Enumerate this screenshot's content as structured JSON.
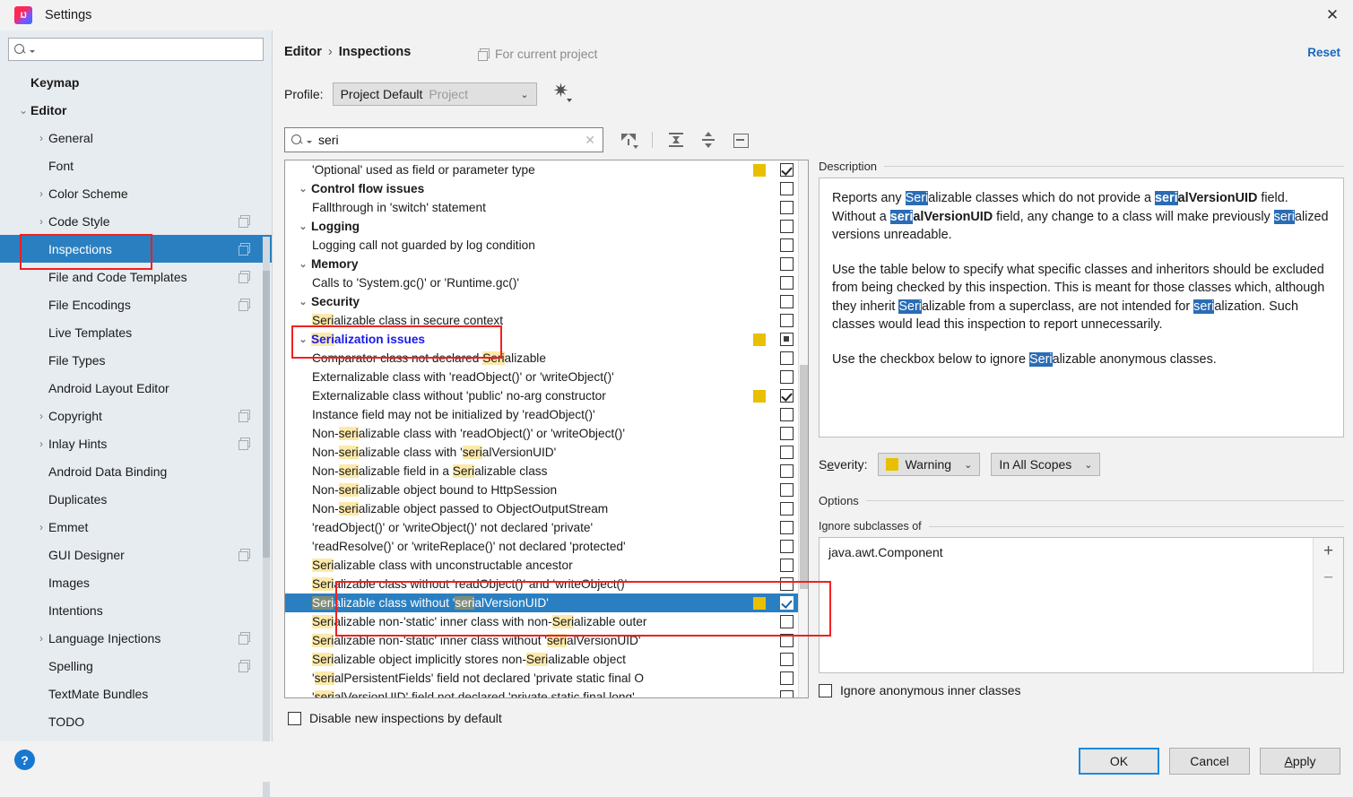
{
  "window": {
    "title": "Settings",
    "close_label": "✕",
    "logo": "intellij-idea-logo"
  },
  "sidebar": {
    "search_placeholder": "",
    "search_value": "",
    "items": [
      {
        "label": "Keymap",
        "indent": 0,
        "arrow": "",
        "bold": true,
        "copy": false,
        "selected": false
      },
      {
        "label": "Editor",
        "indent": 0,
        "arrow": "⌄",
        "bold": true,
        "copy": false,
        "selected": false
      },
      {
        "label": "General",
        "indent": 1,
        "arrow": "›",
        "bold": false,
        "copy": false,
        "selected": false
      },
      {
        "label": "Font",
        "indent": 1,
        "arrow": "",
        "bold": false,
        "copy": false,
        "selected": false
      },
      {
        "label": "Color Scheme",
        "indent": 1,
        "arrow": "›",
        "bold": false,
        "copy": false,
        "selected": false
      },
      {
        "label": "Code Style",
        "indent": 1,
        "arrow": "›",
        "bold": false,
        "copy": true,
        "selected": false
      },
      {
        "label": "Inspections",
        "indent": 1,
        "arrow": "",
        "bold": false,
        "copy": true,
        "selected": true
      },
      {
        "label": "File and Code Templates",
        "indent": 1,
        "arrow": "",
        "bold": false,
        "copy": true,
        "selected": false
      },
      {
        "label": "File Encodings",
        "indent": 1,
        "arrow": "",
        "bold": false,
        "copy": true,
        "selected": false
      },
      {
        "label": "Live Templates",
        "indent": 1,
        "arrow": "",
        "bold": false,
        "copy": false,
        "selected": false
      },
      {
        "label": "File Types",
        "indent": 1,
        "arrow": "",
        "bold": false,
        "copy": false,
        "selected": false
      },
      {
        "label": "Android Layout Editor",
        "indent": 1,
        "arrow": "",
        "bold": false,
        "copy": false,
        "selected": false
      },
      {
        "label": "Copyright",
        "indent": 1,
        "arrow": "›",
        "bold": false,
        "copy": true,
        "selected": false
      },
      {
        "label": "Inlay Hints",
        "indent": 1,
        "arrow": "›",
        "bold": false,
        "copy": true,
        "selected": false
      },
      {
        "label": "Android Data Binding",
        "indent": 1,
        "arrow": "",
        "bold": false,
        "copy": false,
        "selected": false
      },
      {
        "label": "Duplicates",
        "indent": 1,
        "arrow": "",
        "bold": false,
        "copy": false,
        "selected": false
      },
      {
        "label": "Emmet",
        "indent": 1,
        "arrow": "›",
        "bold": false,
        "copy": false,
        "selected": false
      },
      {
        "label": "GUI Designer",
        "indent": 1,
        "arrow": "",
        "bold": false,
        "copy": true,
        "selected": false
      },
      {
        "label": "Images",
        "indent": 1,
        "arrow": "",
        "bold": false,
        "copy": false,
        "selected": false
      },
      {
        "label": "Intentions",
        "indent": 1,
        "arrow": "",
        "bold": false,
        "copy": false,
        "selected": false
      },
      {
        "label": "Language Injections",
        "indent": 1,
        "arrow": "›",
        "bold": false,
        "copy": true,
        "selected": false
      },
      {
        "label": "Spelling",
        "indent": 1,
        "arrow": "",
        "bold": false,
        "copy": true,
        "selected": false
      },
      {
        "label": "TextMate Bundles",
        "indent": 1,
        "arrow": "",
        "bold": false,
        "copy": false,
        "selected": false
      },
      {
        "label": "TODO",
        "indent": 1,
        "arrow": "",
        "bold": false,
        "copy": false,
        "selected": false
      }
    ]
  },
  "header": {
    "breadcrumb_root": "Editor",
    "breadcrumb_sep": "›",
    "breadcrumb_leaf": "Inspections",
    "for_current_project": "For current project",
    "reset_label": "Reset",
    "profile_label": "Profile:",
    "profile_value": "Project Default",
    "profile_scope": "Project",
    "gear_icon": "gear-icon"
  },
  "find": {
    "value": "seri",
    "placeholder": "",
    "clear_label": "✕",
    "toolbar": [
      "filter-icon",
      "expand-all-icon",
      "collapse-all-icon",
      "box-icon"
    ]
  },
  "inspections": {
    "highlight_term": "seri",
    "disable_new_label": "Disable new inspections by default",
    "disable_new_checked": false,
    "rows": [
      {
        "text": "'Optional' used as field or parameter type",
        "group": false,
        "severity": true,
        "check": "checked",
        "selected": false
      },
      {
        "text": "Control flow issues",
        "group": true,
        "severity": false,
        "check": "none",
        "selected": false
      },
      {
        "text": "Fallthrough in 'switch' statement",
        "group": false,
        "severity": false,
        "check": "none",
        "selected": false
      },
      {
        "text": "Logging",
        "group": true,
        "severity": false,
        "check": "none",
        "selected": false
      },
      {
        "text": "Logging call not guarded by log condition",
        "group": false,
        "severity": false,
        "check": "none",
        "selected": false
      },
      {
        "text": "Memory",
        "group": true,
        "severity": false,
        "check": "none",
        "selected": false
      },
      {
        "text": "Calls to 'System.gc()' or 'Runtime.gc()'",
        "group": false,
        "severity": false,
        "check": "none",
        "selected": false
      },
      {
        "text": "Security",
        "group": true,
        "severity": false,
        "check": "none",
        "selected": false
      },
      {
        "text": "Serializable class in secure context",
        "group": false,
        "severity": false,
        "check": "none",
        "selected": false
      },
      {
        "text": "Serialization issues",
        "group": true,
        "severity": true,
        "check": "mixed",
        "selected": false,
        "blue": true
      },
      {
        "text": "Comparator class not declared Serializable",
        "group": false,
        "severity": false,
        "check": "none",
        "selected": false
      },
      {
        "text": "Externalizable class with 'readObject()' or 'writeObject()'",
        "group": false,
        "severity": false,
        "check": "none",
        "selected": false
      },
      {
        "text": "Externalizable class without 'public' no-arg constructor",
        "group": false,
        "severity": true,
        "check": "checked",
        "selected": false
      },
      {
        "text": "Instance field may not be initialized by 'readObject()'",
        "group": false,
        "severity": false,
        "check": "none",
        "selected": false
      },
      {
        "text": "Non-serializable class with 'readObject()' or 'writeObject()'",
        "group": false,
        "severity": false,
        "check": "none",
        "selected": false
      },
      {
        "text": "Non-serializable class with 'serialVersionUID'",
        "group": false,
        "severity": false,
        "check": "none",
        "selected": false
      },
      {
        "text": "Non-serializable field in a Serializable class",
        "group": false,
        "severity": false,
        "check": "none",
        "selected": false
      },
      {
        "text": "Non-serializable object bound to HttpSession",
        "group": false,
        "severity": false,
        "check": "none",
        "selected": false
      },
      {
        "text": "Non-serializable object passed to ObjectOutputStream",
        "group": false,
        "severity": false,
        "check": "none",
        "selected": false
      },
      {
        "text": "'readObject()' or 'writeObject()' not declared 'private'",
        "group": false,
        "severity": false,
        "check": "none",
        "selected": false
      },
      {
        "text": "'readResolve()' or 'writeReplace()' not declared 'protected'",
        "group": false,
        "severity": false,
        "check": "none",
        "selected": false
      },
      {
        "text": "Serializable class with unconstructable ancestor",
        "group": false,
        "severity": false,
        "check": "none",
        "selected": false
      },
      {
        "text": "Serializable class without 'readObject()' and 'writeObject()'",
        "group": false,
        "severity": false,
        "check": "none",
        "selected": false
      },
      {
        "text": "Serializable class without 'serialVersionUID'",
        "group": false,
        "severity": true,
        "check": "checked",
        "selected": true
      },
      {
        "text": "Serializable non-'static' inner class with non-Serializable outer",
        "group": false,
        "severity": false,
        "check": "none",
        "selected": false
      },
      {
        "text": "Serializable non-'static' inner class without 'serialVersionUID'",
        "group": false,
        "severity": false,
        "check": "none",
        "selected": false
      },
      {
        "text": "Serializable object implicitly stores non-Serializable object",
        "group": false,
        "severity": false,
        "check": "none",
        "selected": false
      },
      {
        "text": "'serialPersistentFields' field not declared 'private static final O",
        "group": false,
        "severity": false,
        "check": "none",
        "selected": false
      },
      {
        "text": "'serialVersionUID' field not declared 'private static final long'",
        "group": false,
        "severity": false,
        "check": "none",
        "selected": false
      }
    ]
  },
  "description": {
    "title": "Description",
    "paragraphs": [
      "Reports any Serializable classes which do not provide a serialVersionUID field. Without a serialVersionUID field, any change to a class will make previously serialized versions unreadable.",
      "Use the table below to specify what specific classes and inheritors should be excluded from being checked by this inspection. This is meant for those classes which, although they inherit Serializable from a superclass, are not intended for serialization. Such classes would lead this inspection to report unnecessarily.",
      "Use the checkbox below to ignore Serializable anonymous classes."
    ]
  },
  "severity": {
    "label": "Severity:",
    "value": "Warning",
    "color": "#e8c000",
    "scope_value": "In All Scopes"
  },
  "options": {
    "title": "Options",
    "subclasses_title": "Ignore subclasses of",
    "subclasses": [
      "java.awt.Component"
    ],
    "add_label": "+",
    "remove_label": "−",
    "ignore_anonymous_label": "Ignore anonymous inner classes",
    "ignore_anonymous_checked": false
  },
  "footer": {
    "help_label": "?",
    "ok_label": "OK",
    "cancel_label": "Cancel",
    "apply_label": "Apply"
  },
  "colors": {
    "selection_blue": "#2a7fc1",
    "severity_yellow": "#e8c000",
    "highlight_yellow": "#fde9a9",
    "link_blue": "#1769bf",
    "annotation_red": "#f22020"
  }
}
